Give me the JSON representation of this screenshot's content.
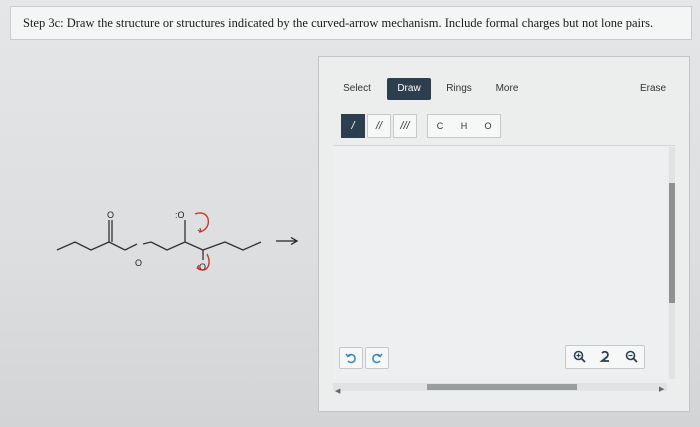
{
  "question": {
    "text": "Step 3c: Draw the structure or structures indicated by the curved-arrow mechanism. Include formal charges but not lone pairs."
  },
  "mechanism": {
    "atom_labels": [
      "O",
      "O",
      ":O",
      "O"
    ],
    "arrow_glyph": "→"
  },
  "editor": {
    "tabs": {
      "select": "Select",
      "draw": "Draw",
      "rings": "Rings",
      "more": "More",
      "erase": "Erase"
    },
    "bonds": [
      "/",
      "//",
      "///"
    ],
    "atoms": [
      "C",
      "H",
      "O"
    ],
    "icons": {
      "undo": "undo-icon",
      "redo": "redo-icon",
      "zoom_in": "zoom-in-icon",
      "reset": "reset-view-icon",
      "zoom_out": "zoom-out-icon"
    },
    "colors": {
      "accent": "#2d3e4e",
      "curved_arrow": "#c0392b"
    }
  }
}
